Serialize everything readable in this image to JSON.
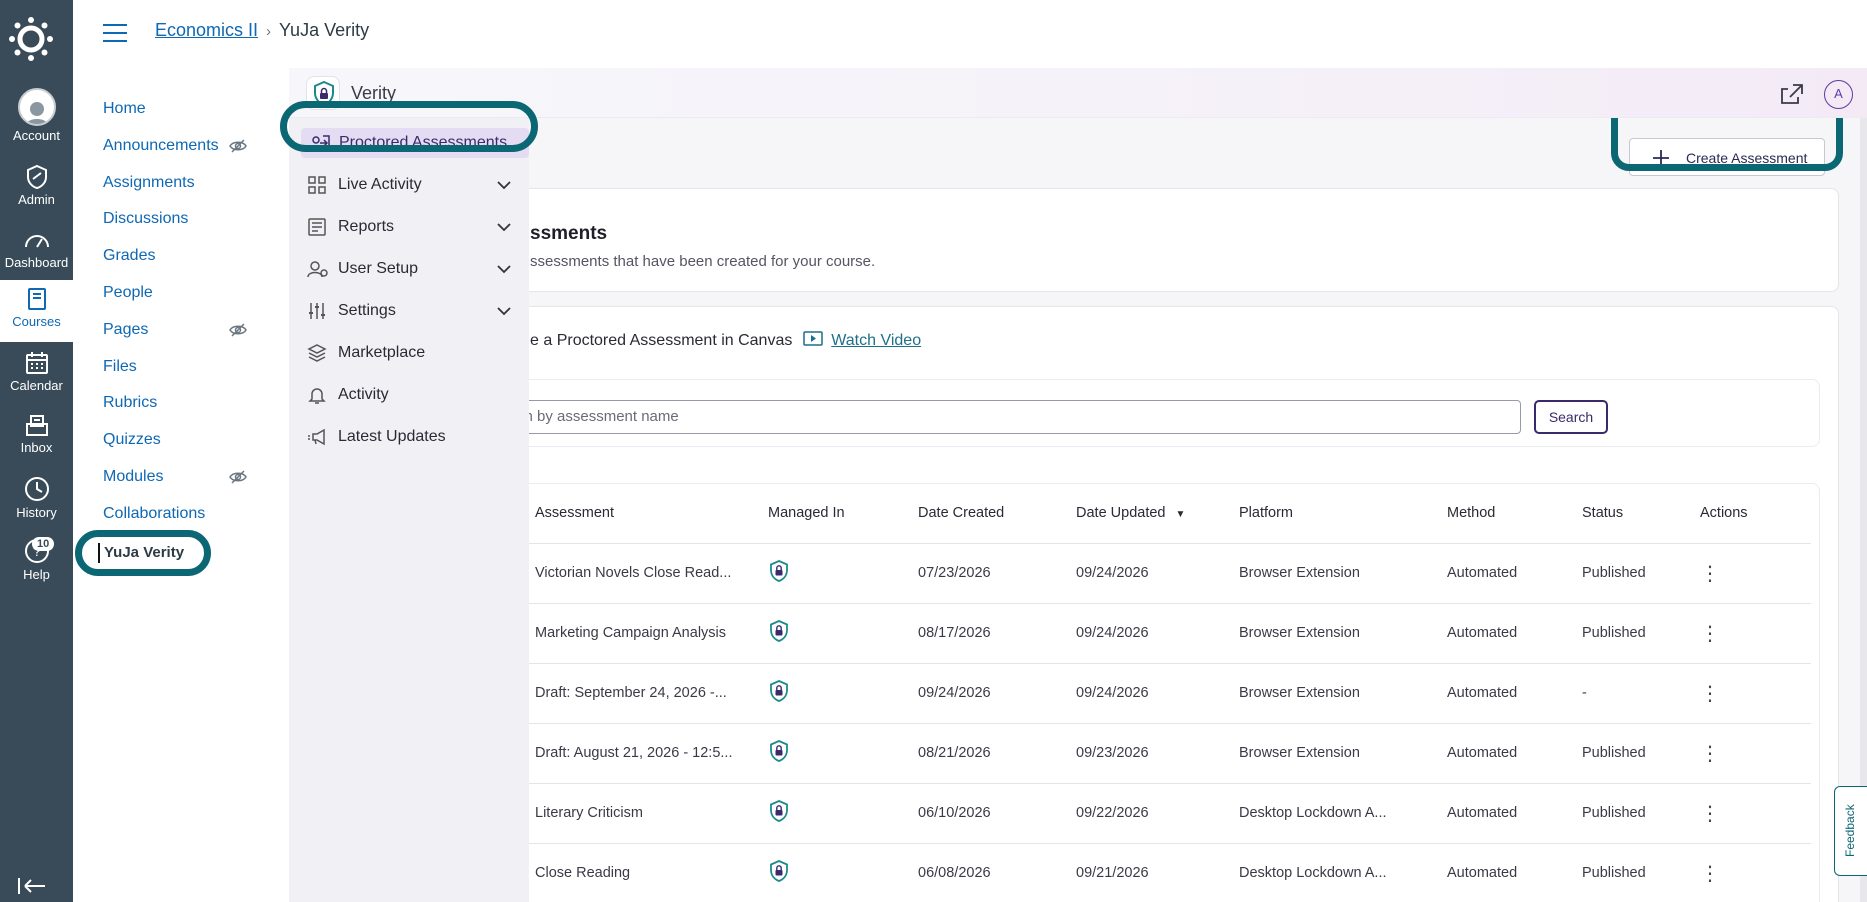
{
  "global_nav": {
    "items": [
      {
        "label": "Account",
        "icon": "account-avatar-icon"
      },
      {
        "label": "Admin",
        "icon": "admin-shield-icon"
      },
      {
        "label": "Dashboard",
        "icon": "dashboard-gauge-icon"
      },
      {
        "label": "Courses",
        "icon": "courses-book-icon",
        "active": true
      },
      {
        "label": "Calendar",
        "icon": "calendar-icon"
      },
      {
        "label": "Inbox",
        "icon": "inbox-icon"
      },
      {
        "label": "History",
        "icon": "history-clock-icon"
      },
      {
        "label": "Help",
        "icon": "help-icon",
        "badge": "10"
      }
    ],
    "collapse_icon": "collapse-nav-icon"
  },
  "breadcrumb": {
    "course": "Economics II",
    "current": "YuJa Verity"
  },
  "course_nav": {
    "items": [
      {
        "label": "Home"
      },
      {
        "label": "Announcements",
        "hidden": true
      },
      {
        "label": "Assignments"
      },
      {
        "label": "Discussions"
      },
      {
        "label": "Grades"
      },
      {
        "label": "People"
      },
      {
        "label": "Pages",
        "hidden": true
      },
      {
        "label": "Files"
      },
      {
        "label": "Rubrics"
      },
      {
        "label": "Quizzes"
      },
      {
        "label": "Modules",
        "hidden": true
      },
      {
        "label": "Collaborations"
      },
      {
        "label": "YuJa Verity",
        "active": true
      }
    ]
  },
  "app": {
    "title": "Verity",
    "user_initial": "A",
    "side_nav": [
      {
        "label": "Proctored Assessments",
        "active": true,
        "expandable": false
      },
      {
        "label": "Live Activity",
        "expandable": true
      },
      {
        "label": "Reports",
        "expandable": true
      },
      {
        "label": "User Setup",
        "expandable": true
      },
      {
        "label": "Settings",
        "expandable": true
      },
      {
        "label": "Marketplace",
        "expandable": false
      },
      {
        "label": "Activity",
        "expandable": false
      },
      {
        "label": "Latest Updates",
        "expandable": false
      }
    ],
    "create_button": "Create Assessment",
    "heading": "ssments",
    "subheading": "ssessments that have been created for your course.",
    "video_text": "e a Proctored Assessment in Canvas",
    "watch_video": "Watch Video",
    "search": {
      "placeholder": "rch by assessment name",
      "button": "Search"
    },
    "feedback": "Feedback"
  },
  "table": {
    "columns": [
      "Assessment",
      "Managed In",
      "Date Created",
      "Date Updated",
      "Platform",
      "Method",
      "Status",
      "Actions"
    ],
    "sort_indicator": "▼",
    "rows": [
      {
        "assessment": "Victorian Novels Close Read...",
        "created": "07/23/2026",
        "updated": "09/24/2026",
        "platform": "Browser Extension",
        "method": "Automated",
        "status": "Published"
      },
      {
        "assessment": "Marketing Campaign Analysis",
        "created": "08/17/2026",
        "updated": "09/24/2026",
        "platform": "Browser Extension",
        "method": "Automated",
        "status": "Published"
      },
      {
        "assessment": "Draft: September 24, 2026 -...",
        "created": "09/24/2026",
        "updated": "09/24/2026",
        "platform": "Browser Extension",
        "method": "Automated",
        "status": "-"
      },
      {
        "assessment": "Draft: August 21, 2026 - 12:5...",
        "created": "08/21/2026",
        "updated": "09/23/2026",
        "platform": "Browser Extension",
        "method": "Automated",
        "status": "Published"
      },
      {
        "assessment": "Literary Criticism",
        "created": "06/10/2026",
        "updated": "09/22/2026",
        "platform": "Desktop Lockdown A...",
        "method": "Automated",
        "status": "Published"
      },
      {
        "assessment": "Close Reading",
        "created": "06/08/2026",
        "updated": "09/21/2026",
        "platform": "Desktop Lockdown A...",
        "method": "Automated",
        "status": "Published"
      }
    ]
  },
  "colors": {
    "canvas_nav": "#394b58",
    "link": "#0e68b3",
    "highlight_ring": "#0c6774",
    "accent": "#3a2a6a"
  }
}
